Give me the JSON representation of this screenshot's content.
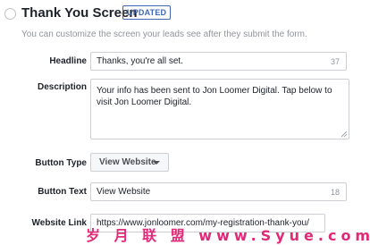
{
  "section": {
    "title": "Thank You Screen",
    "badge": "UPDATED",
    "subtitle": "You can customize the screen your leads see after they submit the form."
  },
  "fields": {
    "headline": {
      "label": "Headline",
      "value": "Thanks, you're all set.",
      "remaining": "37"
    },
    "description": {
      "label": "Description",
      "value": "Your info has been sent to Jon Loomer Digital. Tap below to visit Jon Loomer Digital."
    },
    "button_type": {
      "label": "Button Type",
      "value": "View Website"
    },
    "button_text": {
      "label": "Button Text",
      "value": "View Website",
      "remaining": "18"
    },
    "website_link": {
      "label": "Website Link",
      "value": "https://www.jonloomer.com/my-registration-thank-you/"
    }
  },
  "watermark": "岁 月 联 盟 www.Syue.com",
  "colors": {
    "accent": "#4267b2",
    "watermark": "#e02a78"
  }
}
